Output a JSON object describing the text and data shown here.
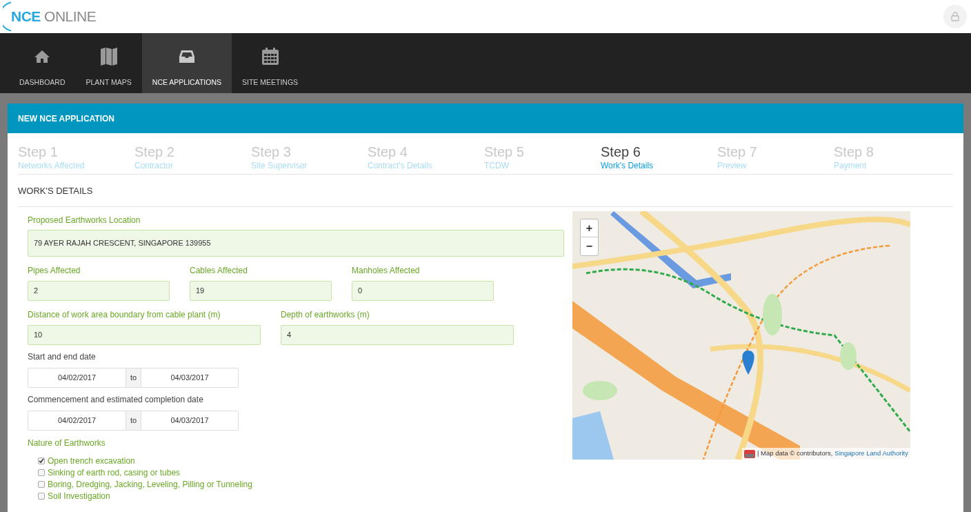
{
  "logo": {
    "part_1": "NCE",
    "part_2": "ONLINE"
  },
  "nav": [
    {
      "label": "DASHBOARD",
      "selected": false
    },
    {
      "label": "PLANT MAPS",
      "selected": false
    },
    {
      "label": "NCE APPLICATIONS",
      "selected": true
    },
    {
      "label": "SITE MEETINGS",
      "selected": false
    }
  ],
  "panel_title": "NEW NCE APPLICATION",
  "steps": [
    {
      "title": "Step 1",
      "label": "Networks Affected",
      "selected": false
    },
    {
      "title": "Step 2",
      "label": "Contractor",
      "selected": false
    },
    {
      "title": "Step 3",
      "label": "Site Supervisor",
      "selected": false
    },
    {
      "title": "Step 4",
      "label": "Contract's Details",
      "selected": false
    },
    {
      "title": "Step 5",
      "label": "TCDW",
      "selected": false
    },
    {
      "title": "Step 6",
      "label": "Work's Details",
      "selected": true
    },
    {
      "title": "Step 7",
      "label": "Preview",
      "selected": false
    },
    {
      "title": "Step 8",
      "label": "Payment",
      "selected": false
    }
  ],
  "section_title": "WORK'S DETAILS",
  "location": {
    "label": "Proposed Earthworks Location",
    "value": "79 AYER RAJAH CRESCENT, SINGAPORE 139955"
  },
  "counts": [
    {
      "label": "Pipes Affected",
      "value": "2"
    },
    {
      "label": "Cables Affected",
      "value": "19"
    },
    {
      "label": "Manholes Affected",
      "value": "0"
    }
  ],
  "measures": [
    {
      "label": "Distance of work area boundary from cable plant (m)",
      "value": "10"
    },
    {
      "label": "Depth of earthworks (m)",
      "value": "4"
    }
  ],
  "date_ranges": [
    {
      "label": "Start and end date",
      "from": "04/02/2017",
      "separator": "to",
      "to": "04/03/2017"
    },
    {
      "label": "Commencement and estimated completion date",
      "from": "04/02/2017",
      "separator": "to",
      "to": "04/03/2017"
    }
  ],
  "nature": {
    "label": "Nature of Earthworks",
    "options": [
      {
        "label": "Open trench excavation",
        "checked": true
      },
      {
        "label": "Sinking of earth rod, casing or tubes",
        "checked": false
      },
      {
        "label": "Boring, Dredging, Jacking, Leveling, Pilling or Tunneling",
        "checked": false
      },
      {
        "label": "Soil Investigation",
        "checked": false
      }
    ]
  },
  "map": {
    "kind": "picture",
    "zoom_in": "+",
    "zoom_out": "−",
    "attribution": "| Map data © contributors,",
    "attribution_link": "Singapore Land Authority"
  }
}
